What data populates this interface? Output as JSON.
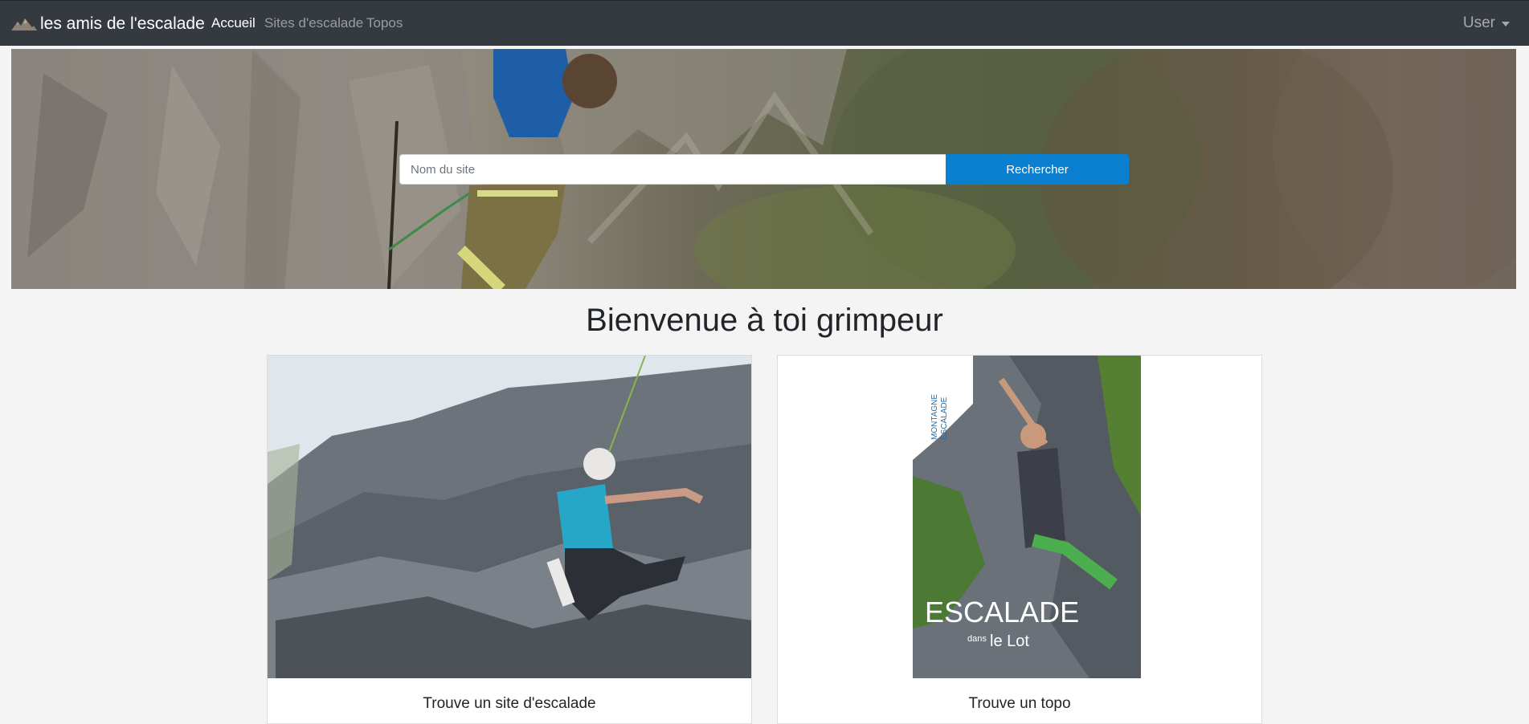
{
  "navbar": {
    "brand": "les amis de l'escalade",
    "links": [
      {
        "label": "Accueil",
        "active": true
      },
      {
        "label": "Sites d'escalade",
        "active": false
      },
      {
        "label": "Topos",
        "active": false
      }
    ],
    "user_label": "User"
  },
  "hero": {
    "search": {
      "placeholder": "Nom du site",
      "value": ""
    },
    "search_button": "Rechercher"
  },
  "welcome_title": "Bienvenue à toi grimpeur",
  "cards": [
    {
      "title": "Trouve un site d'escalade",
      "image": "climber-on-rock-photo"
    },
    {
      "title": "Trouve un topo",
      "image": "guidebook-cover",
      "cover": {
        "publisher_1": "MONTAGNE",
        "publisher_2": "ESCALADE",
        "title": "ESCALADE",
        "small": "dans",
        "place": "le Lot"
      }
    }
  ],
  "colors": {
    "navbar_bg": "#343a40",
    "primary_button": "#0a7fcf",
    "page_bg": "#f4f4f4"
  }
}
